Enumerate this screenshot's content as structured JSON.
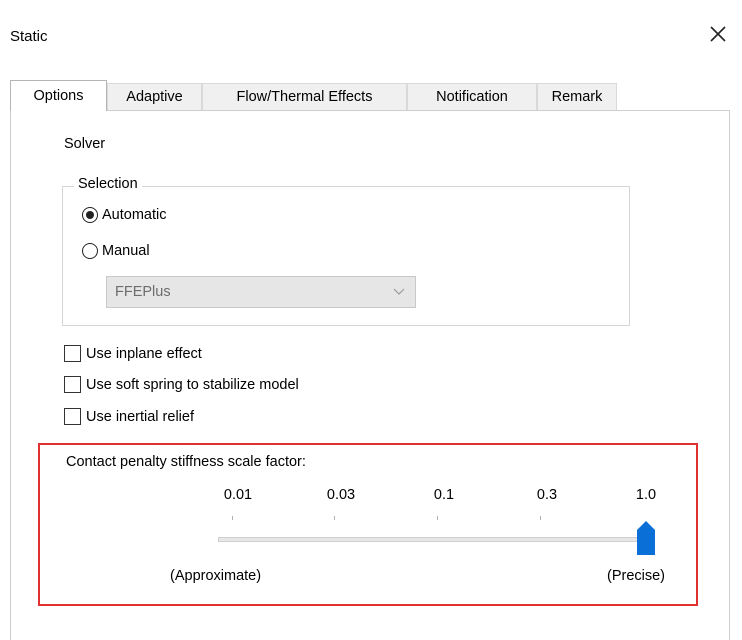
{
  "window": {
    "title": "Static"
  },
  "tabs": [
    {
      "label": "Options",
      "active": true
    },
    {
      "label": "Adaptive",
      "active": false
    },
    {
      "label": "Flow/Thermal Effects",
      "active": false
    },
    {
      "label": "Notification",
      "active": false
    },
    {
      "label": "Remark",
      "active": false
    }
  ],
  "solver": {
    "heading": "Solver",
    "selection_legend": "Selection",
    "options": [
      {
        "label": "Automatic",
        "checked": true
      },
      {
        "label": "Manual",
        "checked": false
      }
    ],
    "dropdown": {
      "value": "FFEPlus",
      "enabled": false
    }
  },
  "checkboxes": [
    {
      "label": "Use inplane effect",
      "checked": false
    },
    {
      "label": "Use soft spring to stabilize model",
      "checked": false
    },
    {
      "label": "Use inertial relief",
      "checked": false
    }
  ],
  "contact_penalty": {
    "label": "Contact penalty stiffness scale factor:",
    "ticks": [
      "0.01",
      "0.03",
      "0.1",
      "0.3",
      "1.0"
    ],
    "selected_index": 4,
    "min_label": "(Approximate)",
    "max_label": "(Precise)"
  },
  "colors": {
    "slider_thumb": "#0a6fd6",
    "highlight_border": "#e03030"
  }
}
